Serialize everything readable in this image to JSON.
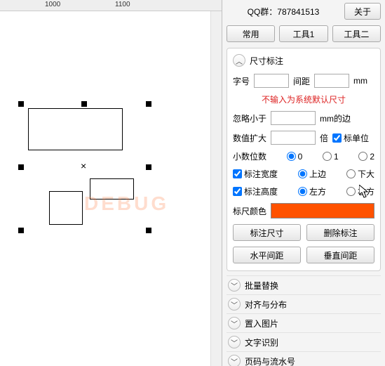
{
  "ruler": {
    "t1": "1000",
    "t2": "1100"
  },
  "topbar": {
    "qq_label": "QQ群：787841513",
    "about": "关于"
  },
  "tabs": {
    "common": "常用",
    "tool1": "工具1",
    "tool2": "工具二"
  },
  "dim": {
    "title": "尺寸标注",
    "font_label": "字号",
    "font_val": "",
    "gap_label": "间距",
    "gap_val": "",
    "unit_mm": "mm",
    "warning": "不输入为系统默认尺寸",
    "ignore_label": "忽略小于",
    "ignore_val": "",
    "ignore_suffix": "mm的边",
    "scale_label": "数值扩大",
    "scale_val": "",
    "scale_suffix": "倍",
    "mark_unit": "标单位",
    "decimals_label": "小数位数",
    "dec0": "0",
    "dec1": "1",
    "dec2": "2",
    "mark_width": "标注宽度",
    "top": "上边",
    "bottom": "下大",
    "mark_height": "标注高度",
    "left": "左方",
    "right": "右方",
    "color_label": "标尺颜色",
    "color_val": "#ff5200",
    "btn_mark": "标注尺寸",
    "btn_del": "删除标注",
    "btn_hgap": "水平间距",
    "btn_vgap": "垂直间距"
  },
  "acc": {
    "a1": "批量替换",
    "a2": "对齐与分布",
    "a3": "置入图片",
    "a4": "文字识别",
    "a5": "页码与流水号"
  }
}
